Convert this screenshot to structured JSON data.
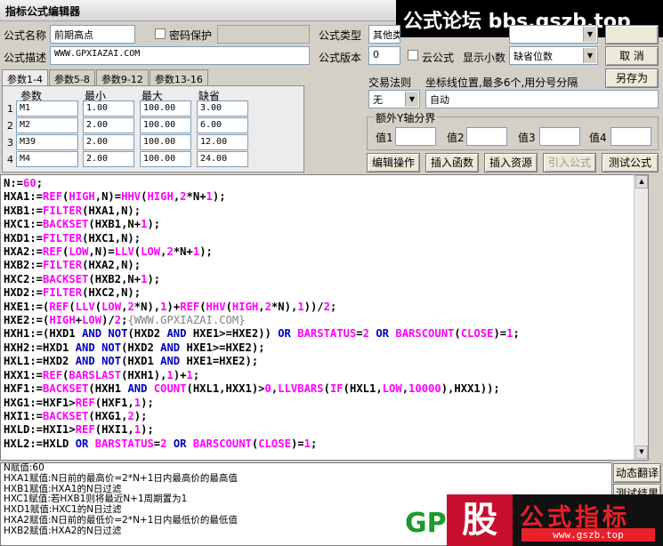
{
  "window": {
    "title": "指标公式编辑器"
  },
  "watermark_top": "公式论坛 bbs.gszb.top",
  "watermark_bottom": {
    "gp": "GP",
    "gu": "股",
    "name": "公式指标",
    "url": "www.gszb.top"
  },
  "form": {
    "name_label": "公式名称",
    "name_value": "前期高点",
    "password_label": "密码保护",
    "password_checked": false,
    "desc_label": "公式描述",
    "desc_value": "WWW.GPXIAZAI.COM",
    "type_label": "公式类型",
    "type_value": "其他类",
    "version_label": "公式版本",
    "version_value": "0",
    "cloud_label": "云公式",
    "cloud_checked": false,
    "decimals_label": "显示小数",
    "decimals_value": "缺省位数",
    "trade_label": "交易法则",
    "trade_value": "无",
    "coord_label": "坐标线位置,最多6个,用分号分隔",
    "coord_value": "自动",
    "yaxis_label": "额外Y轴分界",
    "y1_label": "值1",
    "y2_label": "值2",
    "y3_label": "值3",
    "y4_label": "值4"
  },
  "buttons": {
    "cancel": "取  消",
    "save_as": "另存为",
    "edit_ops": "编辑操作",
    "insert_func": "插入函数",
    "insert_res": "插入资源",
    "import_formula": "引入公式",
    "test_formula": "测试公式",
    "dyn_translate": "动态翻译",
    "test_result": "测试结果"
  },
  "param_tabs": [
    "参数1-4",
    "参数5-8",
    "参数9-12",
    "参数13-16"
  ],
  "param_headers": {
    "name": "参数",
    "min": "最小",
    "max": "最大",
    "default": "缺省"
  },
  "params": [
    {
      "no": "1",
      "name": "M1",
      "min": "1.00",
      "max": "100.00",
      "default": "3.00"
    },
    {
      "no": "2",
      "name": "M2",
      "min": "2.00",
      "max": "100.00",
      "default": "6.00"
    },
    {
      "no": "3",
      "name": "M39",
      "min": "2.00",
      "max": "100.00",
      "default": "12.00"
    },
    {
      "no": "4",
      "name": "M4",
      "min": "2.00",
      "max": "100.00",
      "default": "24.00"
    }
  ],
  "code_lines": [
    "N:=60;",
    "HXA1:=REF(HIGH,N)=HHV(HIGH,2*N+1);",
    "HXB1:=FILTER(HXA1,N);",
    "HXC1:=BACKSET(HXB1,N+1);",
    "HXD1:=FILTER(HXC1,N);",
    "HXA2:=REF(LOW,N)=LLV(LOW,2*N+1);",
    "HXB2:=FILTER(HXA2,N);",
    "HXC2:=BACKSET(HXB2,N+1);",
    "HXD2:=FILTER(HXC2,N);",
    "HXE1:=(REF(LLV(LOW,2*N),1)+REF(HHV(HIGH,2*N),1))/2;",
    "HXE2:=(HIGH+LOW)/2;{WWW.GPXIAZAI.COM}",
    "HXH1:=(HXD1 AND NOT(HXD2 AND HXE1>=HXE2)) OR BARSTATUS=2 OR BARSCOUNT(CLOSE)=1;",
    "HXH2:=HXD1 AND NOT(HXD2 AND HXE1>=HXE2);",
    "HXL1:=HXD2 AND NOT(HXD1 AND HXE1=HXE2);",
    "HXX1:=REF(BARSLAST(HXH1),1)+1;",
    "HXF1:=BACKSET(HXH1 AND COUNT(HXL1,HXX1)>0,LLVBARS(IF(HXL1,LOW,10000),HXX1));",
    "HXG1:=HXF1>REF(HXF1,1);",
    "HXI1:=BACKSET(HXG1,2);",
    "HXLD:=HXI1>REF(HXI1,1);",
    "HXL2:=HXLD OR BARSTATUS=2 OR BARSCOUNT(CLOSE)=1;"
  ],
  "output_lines": [
    "N赋值:60",
    "HXA1赋值:N日前的最高价=2*N+1日内最高价的最高值",
    "HXB1赋值:HXA1的N日过滤",
    "HXC1赋值:若HXB1则将最近N+1周期置为1",
    "HXD1赋值:HXC1的N日过滤",
    "HXA2赋值:N日前的最低价=2*N+1日内最低价的最低值",
    "HXB2赋值:HXA2的N日过滤"
  ]
}
